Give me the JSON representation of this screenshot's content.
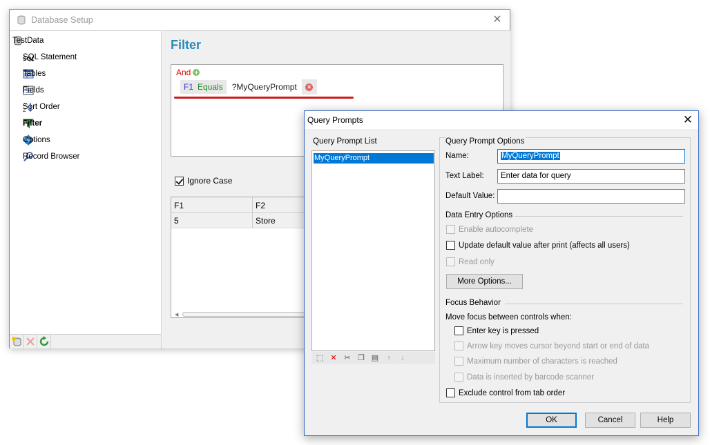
{
  "main_window": {
    "title": "Database Setup",
    "tree": {
      "root": "TestData",
      "items": [
        {
          "label": "SQL Statement",
          "icon": "sql-icon"
        },
        {
          "label": "Tables",
          "icon": "tables-icon"
        },
        {
          "label": "Fields",
          "icon": "fields-icon"
        },
        {
          "label": "Sort Order",
          "icon": "sort-order-icon"
        },
        {
          "label": "Filter",
          "icon": "filter-icon",
          "selected": true
        },
        {
          "label": "Options",
          "icon": "gear-icon"
        },
        {
          "label": "Record Browser",
          "icon": "search-icon"
        }
      ]
    },
    "content": {
      "heading": "Filter",
      "filter": {
        "operator": "And",
        "field": "F1",
        "comparison": "Equals",
        "value": "?MyQueryPrompt"
      },
      "ignore_case_label": "Ignore Case",
      "ignore_case_checked": true,
      "grid": {
        "headers": [
          "F1",
          "F2"
        ],
        "rows": [
          [
            "5",
            "Store"
          ]
        ]
      }
    }
  },
  "dialog": {
    "title": "Query Prompts",
    "list_label": "Query Prompt List",
    "list_items": [
      "MyQueryPrompt"
    ],
    "options_title": "Query Prompt Options",
    "name_label": "Name:",
    "name_value": "MyQueryPrompt",
    "text_label_label": "Text Label:",
    "text_label_value": "Enter data for query",
    "default_value_label": "Default Value:",
    "default_value_value": "",
    "data_entry_title": "Data Entry Options",
    "enable_autocomplete": "Enable autocomplete",
    "update_default": "Update default value after print (affects all users)",
    "read_only": "Read only",
    "more_options": "More Options...",
    "focus_title": "Focus Behavior",
    "move_focus_label": "Move focus between controls when:",
    "enter_key": "Enter key is pressed",
    "arrow_key": "Arrow key moves cursor beyond start or end of data",
    "max_chars": "Maximum number of characters is reached",
    "barcode": "Data is inserted by barcode scanner",
    "exclude_tab": "Exclude control from tab order",
    "ok": "OK",
    "cancel": "Cancel",
    "help": "Help"
  },
  "colors": {
    "heading": "#2a8ab8",
    "selection": "#0078d7",
    "operator": "#dd0000",
    "field": "#3a3ad0",
    "comparison": "#1e8a1e",
    "underline": "#d01818"
  }
}
